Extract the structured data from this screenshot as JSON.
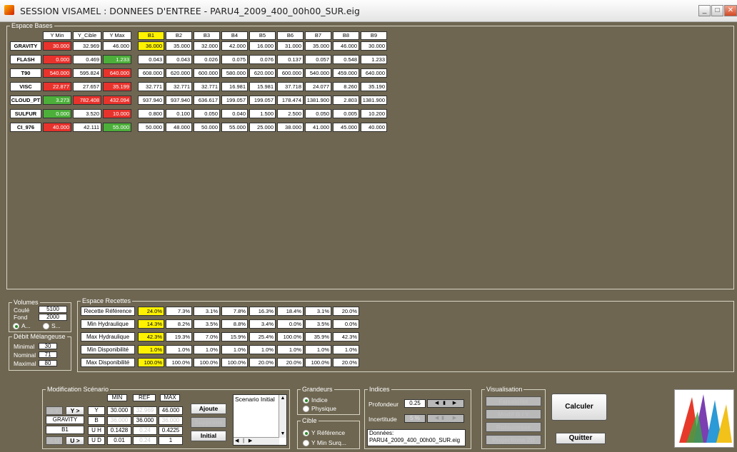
{
  "window": {
    "title": "SESSION VISAMEL : DONNEES D'ENTREE - PARU4_2009_400_00h00_SUR.eig"
  },
  "bases": {
    "title": "Espace Bases",
    "yheaders": [
      "Y Min",
      "Y_Cible",
      "Y Max"
    ],
    "bheaders": [
      "B1",
      "B2",
      "B3",
      "B4",
      "B5",
      "B6",
      "B7",
      "B8",
      "B9"
    ],
    "rows": [
      {
        "label": "GRAVITY",
        "y": [
          "30.000",
          "32.969",
          "46.000"
        ],
        "b": [
          "36.000",
          "35.000",
          "32.000",
          "42.000",
          "16.000",
          "31.000",
          "35.000",
          "46.000",
          "30.000"
        ]
      },
      {
        "label": "FLASH",
        "y": [
          "0.000",
          "0.469",
          "1.233"
        ],
        "b": [
          "0.043",
          "0.043",
          "0.026",
          "0.075",
          "0.076",
          "0.137",
          "0.057",
          "0.548",
          "1.233"
        ]
      },
      {
        "label": "T90",
        "y": [
          "540.000",
          "595.824",
          "640.000"
        ],
        "b": [
          "608.000",
          "620.000",
          "600.000",
          "580.000",
          "620.000",
          "600.000",
          "540.000",
          "459.000",
          "640.000"
        ]
      },
      {
        "label": "VISC",
        "y": [
          "22.877",
          "27.657",
          "35.199"
        ],
        "b": [
          "32.771",
          "32.771",
          "32.771",
          "16.981",
          "15.981",
          "37.718",
          "24.077",
          "8.260",
          "35.190"
        ]
      },
      {
        "label": "CLOUD_PT",
        "y": [
          "3.273",
          "782.408",
          "432.094"
        ],
        "b": [
          "937.940",
          "937.940",
          "636.617",
          "199.057",
          "199.057",
          "178.474",
          "1381.900",
          "2.803",
          "1381.900"
        ]
      },
      {
        "label": "SULFUR",
        "y": [
          "0.000",
          "3.520",
          "10.000"
        ],
        "b": [
          "0.800",
          "0.100",
          "0.050",
          "0.040",
          "1.500",
          "2.500",
          "0.050",
          "0.005",
          "10.200"
        ]
      },
      {
        "label": "CI_976",
        "y": [
          "40.000",
          "42.111",
          "55.000"
        ],
        "b": [
          "50.000",
          "48.000",
          "50.000",
          "55.000",
          "25.000",
          "38.000",
          "41.000",
          "45.000",
          "40.000"
        ]
      }
    ]
  },
  "volumes": {
    "title": "Volumes",
    "coule_label": "Coulé",
    "coule_value": "5100",
    "fond_label": "Fond",
    "fond_value": "2000",
    "radio_a": "A...",
    "radio_s": "S..."
  },
  "debit": {
    "title": "Débit Mélangeuse",
    "minimal_label": "Minimal",
    "minimal_value": "30",
    "nominal_label": "Nominal",
    "nominal_value": "71",
    "maximal_label": "Maximal",
    "maximal_value": "80"
  },
  "recettes": {
    "title": "Espace Recettes",
    "rows": [
      {
        "label": "Recette Référence",
        "values": [
          "24.0%",
          "7.3%",
          "3.1%",
          "7.8%",
          "16.3%",
          "18.4%",
          "3.1%",
          "20.0%"
        ]
      },
      {
        "label": "Min Hydraulique",
        "values": [
          "14.3%",
          "8.2%",
          "3.5%",
          "8.8%",
          "3.4%",
          "0.0%",
          "3.5%",
          "0.0%"
        ]
      },
      {
        "label": "Max Hydraulique",
        "values": [
          "42.3%",
          "19.3%",
          "7.0%",
          "15.9%",
          "25.4%",
          "100.0%",
          "35.9%",
          "42.3%"
        ]
      },
      {
        "label": "Min Disponibilité",
        "values": [
          "1.0%",
          "1.0%",
          "1.0%",
          "1.0%",
          "1.0%",
          "1.0%",
          "1.0%",
          "1.0%"
        ]
      },
      {
        "label": "Max Disponibilité",
        "values": [
          "100.0%",
          "100.0%",
          "100.0%",
          "100.0%",
          "20.0%",
          "20.0%",
          "100.0%",
          "20.0%"
        ]
      }
    ]
  },
  "scenario": {
    "title": "Modification Scénario",
    "col_min": "MIN",
    "col_ref": "REF",
    "col_max": "MAX",
    "btn_yless": "< Y",
    "btn_ygreater": "Y >",
    "gravity": "GRAVITY",
    "b1": "B1",
    "btn_uless": "< U",
    "btn_ugreater": "U >",
    "row_y": {
      "label": "Y",
      "min": "30.000",
      "ref": "32.969",
      "max": "46.000"
    },
    "row_b": {
      "label": "B",
      "min": "36.000",
      "ref": "36.000",
      "max": "36.000"
    },
    "row_uh": {
      "label": "U H",
      "min": "0.1428",
      "ref": "0.24",
      "max": "0.4225"
    },
    "row_ud": {
      "label": "U D",
      "min": "0.01",
      "ref": "0.24",
      "max": "1"
    },
    "btn_ajoute": "Ajoute",
    "btn_supprime": "Supprime",
    "btn_initial": "Initial",
    "list_item": "Scenario Initial"
  },
  "grandeurs": {
    "title": "Grandeurs",
    "opt1": "Indice",
    "opt2": "Physique"
  },
  "cible": {
    "title": "Cible",
    "opt1": "Y Référence",
    "opt2": "Y Min Surq..."
  },
  "indices": {
    "title": "Indices",
    "profondeur_label": "Profondeur",
    "profondeur_value": "0.25",
    "incertitude_label": "Incertitude",
    "incertitude_value": "5 %",
    "donnees_label": "Données:",
    "donnees_value": "PARU4_2009_400_00h00_SUR.eig"
  },
  "visualisation": {
    "title": "Visualisation",
    "b1": "Faisabilité",
    "b2": "Modif B / Y",
    "b3": "Robustesse",
    "b4": "Projections 2D"
  },
  "actions": {
    "calculer": "Calculer",
    "quitter": "Quitter"
  },
  "colors": {
    "background": "#6e6651",
    "red": "#e8322c",
    "green": "#4caf3a",
    "yellow": "#fff200"
  }
}
